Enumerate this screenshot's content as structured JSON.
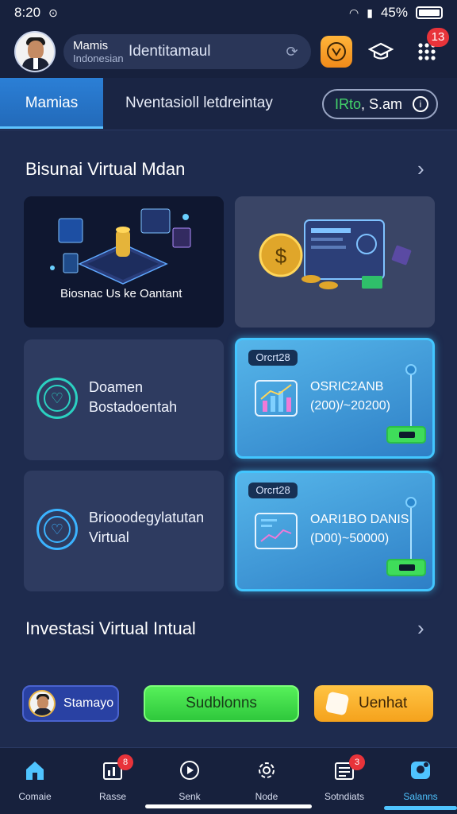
{
  "status_bar": {
    "time": "8:20",
    "battery": "45%"
  },
  "header": {
    "user_name": "Mamis",
    "user_sub": "Indonesian",
    "search_text": "Identitamaul",
    "notification_count": "13"
  },
  "tabs": {
    "active": "Mamias",
    "second": "Nventasioll letdreintay",
    "filter_prefix": "IRto",
    "filter_suffix": ", S.am"
  },
  "section1": {
    "title": "Bisunai Virtual Mdan",
    "hero1_caption": "Biosnac Us ke Oantant"
  },
  "cards": {
    "a": {
      "line1": "Doamen",
      "line2": "Bostadoentah"
    },
    "b": {
      "line1": "Briooodegylatutan",
      "line2": "Virtual"
    },
    "c": {
      "tag": "Orcrt28",
      "title": "OSRIC2ANB",
      "sub": "(200)/~20200)"
    },
    "d": {
      "tag": "Orcrt28",
      "title": "OARI1BO DANIS",
      "sub": "(D00)~50000)"
    }
  },
  "section2": {
    "title": "Investasi Virtual Intual"
  },
  "actions": {
    "user_button": "Stamayo",
    "green_button": "Sudblonns",
    "orange_button": "Uenhat"
  },
  "bottom_nav": [
    {
      "label": "Comaie"
    },
    {
      "label": "Rasse",
      "badge": "8"
    },
    {
      "label": "Senk"
    },
    {
      "label": "Node"
    },
    {
      "label": "Sotndiats",
      "badge": "3"
    },
    {
      "label": "Salanns"
    }
  ],
  "colors": {
    "accent": "#4fc4ff",
    "background": "#1e2b4e",
    "green": "#43d46a",
    "orange": "#f5a21c"
  }
}
